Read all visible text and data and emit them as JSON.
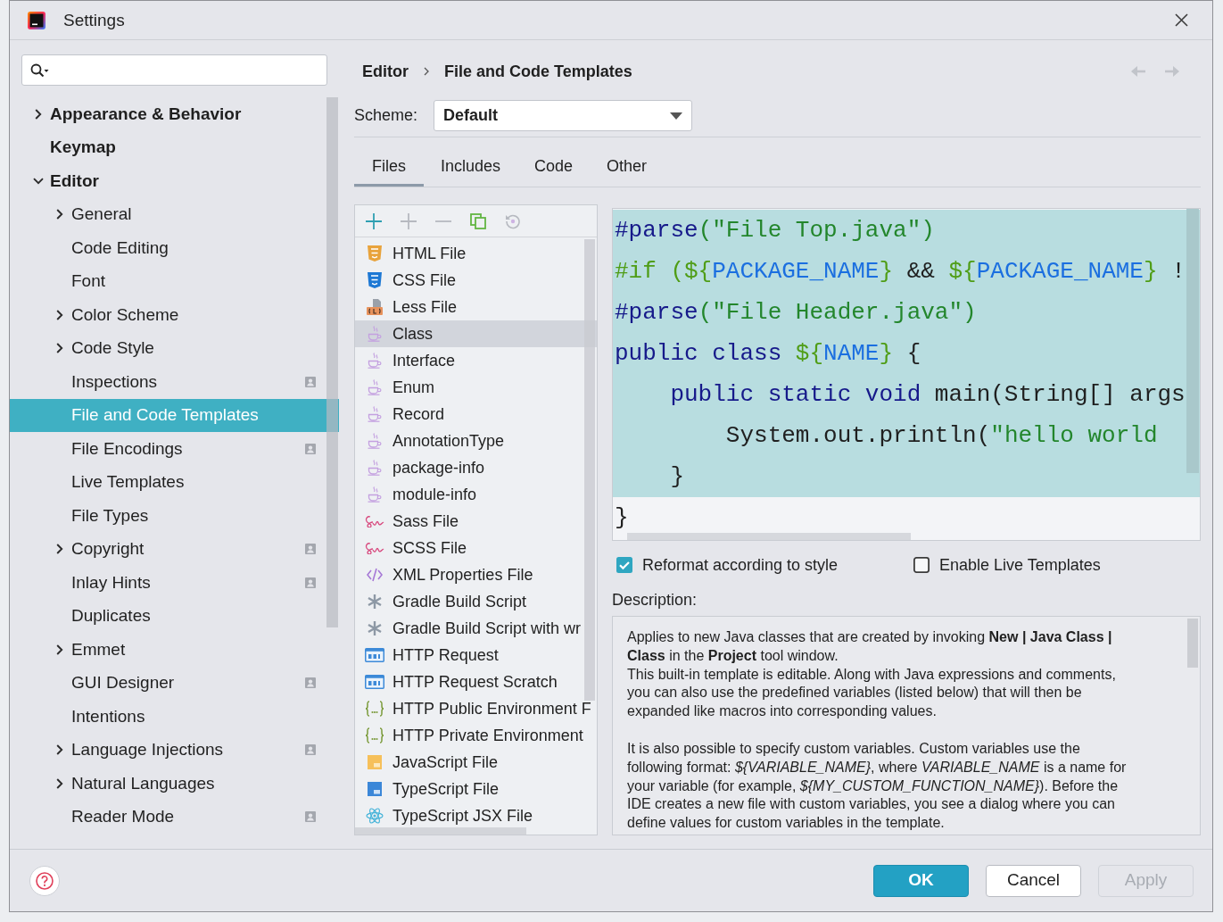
{
  "window": {
    "title": "Settings"
  },
  "sidebar": {
    "items": [
      {
        "label": "Appearance & Behavior",
        "expanded": false,
        "selected": false,
        "badge": false
      },
      {
        "label": "Keymap",
        "selected": false,
        "badge": false
      },
      {
        "label": "Editor",
        "expanded": true,
        "selected": false,
        "badge": false,
        "children": [
          {
            "label": "General",
            "expanded": false,
            "selected": false,
            "badge": false
          },
          {
            "label": "Code Editing",
            "selected": false,
            "badge": false
          },
          {
            "label": "Font",
            "selected": false,
            "badge": false
          },
          {
            "label": "Color Scheme",
            "expanded": false,
            "selected": false,
            "badge": false
          },
          {
            "label": "Code Style",
            "expanded": false,
            "selected": false,
            "badge": false
          },
          {
            "label": "Inspections",
            "selected": false,
            "badge": true
          },
          {
            "label": "File and Code Templates",
            "selected": true,
            "badge": false
          },
          {
            "label": "File Encodings",
            "selected": false,
            "badge": true
          },
          {
            "label": "Live Templates",
            "selected": false,
            "badge": false
          },
          {
            "label": "File Types",
            "selected": false,
            "badge": false
          },
          {
            "label": "Copyright",
            "expanded": false,
            "selected": false,
            "badge": true
          },
          {
            "label": "Inlay Hints",
            "selected": false,
            "badge": true
          },
          {
            "label": "Duplicates",
            "selected": false,
            "badge": false
          },
          {
            "label": "Emmet",
            "expanded": false,
            "selected": false,
            "badge": false
          },
          {
            "label": "GUI Designer",
            "selected": false,
            "badge": true
          },
          {
            "label": "Intentions",
            "selected": false,
            "badge": false
          },
          {
            "label": "Language Injections",
            "expanded": false,
            "selected": false,
            "badge": true
          },
          {
            "label": "Natural Languages",
            "expanded": false,
            "selected": false,
            "badge": false
          },
          {
            "label": "Reader Mode",
            "selected": false,
            "badge": true
          }
        ]
      }
    ]
  },
  "breadcrumb": [
    "Editor",
    "File and Code Templates"
  ],
  "navigation": {
    "back": {
      "disabled": true
    },
    "forward": {
      "disabled": true
    }
  },
  "scheme": {
    "label": "Scheme:",
    "value": "Default"
  },
  "tabs": [
    {
      "label": "Files",
      "selected": true
    },
    {
      "label": "Includes",
      "selected": false
    },
    {
      "label": "Code",
      "selected": false
    },
    {
      "label": "Other",
      "selected": false
    }
  ],
  "template_toolbar": [
    {
      "kind": "add",
      "disabled": false
    },
    {
      "kind": "add",
      "disabled": true
    },
    {
      "kind": "remove",
      "disabled": true
    },
    {
      "kind": "copy",
      "disabled": false
    },
    {
      "kind": "reset",
      "disabled": true
    }
  ],
  "templates": [
    {
      "label": "HTML File",
      "kind": "html",
      "selected": false
    },
    {
      "label": "CSS File",
      "kind": "css",
      "selected": false
    },
    {
      "label": "Less File",
      "kind": "less",
      "selected": false
    },
    {
      "label": "Class",
      "kind": "java",
      "selected": true
    },
    {
      "label": "Interface",
      "kind": "java",
      "selected": false
    },
    {
      "label": "Enum",
      "kind": "java",
      "selected": false
    },
    {
      "label": "Record",
      "kind": "java",
      "selected": false
    },
    {
      "label": "AnnotationType",
      "kind": "java",
      "selected": false
    },
    {
      "label": "package-info",
      "kind": "java",
      "selected": false
    },
    {
      "label": "module-info",
      "kind": "java",
      "selected": false
    },
    {
      "label": "Sass File",
      "kind": "sass",
      "selected": false
    },
    {
      "label": "SCSS File",
      "kind": "sass",
      "selected": false
    },
    {
      "label": "XML Properties File",
      "kind": "xml",
      "selected": false
    },
    {
      "label": "Gradle Build Script",
      "kind": "gradle",
      "selected": false
    },
    {
      "label": "Gradle Build Script with wr",
      "kind": "gradle",
      "selected": false
    },
    {
      "label": "HTTP Request",
      "kind": "http",
      "selected": false
    },
    {
      "label": "HTTP Request Scratch",
      "kind": "http",
      "selected": false
    },
    {
      "label": "HTTP Public Environment F",
      "kind": "env",
      "selected": false
    },
    {
      "label": "HTTP Private Environment",
      "kind": "env",
      "selected": false
    },
    {
      "label": "JavaScript File",
      "kind": "js",
      "selected": false
    },
    {
      "label": "TypeScript File",
      "kind": "ts",
      "selected": false
    },
    {
      "label": "TypeScript JSX File",
      "kind": "tsx",
      "selected": false
    }
  ],
  "code": {
    "lines": [
      {
        "highlighted": true,
        "tokens": [
          {
            "kind": "directive",
            "text": "#parse"
          },
          {
            "kind": "string",
            "text": "(\"File Top.java\")"
          }
        ]
      },
      {
        "highlighted": true,
        "tokens": [
          {
            "kind": "velocity",
            "text": "#if (${"
          },
          {
            "kind": "variable",
            "text": "PACKAGE_NAME"
          },
          {
            "kind": "velocity",
            "text": "}"
          },
          {
            "kind": "plain",
            "text": " && "
          },
          {
            "kind": "velocity",
            "text": "${"
          },
          {
            "kind": "variable",
            "text": "PACKAGE_NAME"
          },
          {
            "kind": "velocity",
            "text": "}"
          },
          {
            "kind": "plain",
            "text": " !"
          }
        ]
      },
      {
        "highlighted": true,
        "tokens": [
          {
            "kind": "directive",
            "text": "#parse"
          },
          {
            "kind": "string",
            "text": "(\"File Header.java\")"
          }
        ]
      },
      {
        "highlighted": true,
        "tokens": [
          {
            "kind": "keyword",
            "text": "public class "
          },
          {
            "kind": "velocity",
            "text": "${"
          },
          {
            "kind": "variable",
            "text": "NAME"
          },
          {
            "kind": "velocity",
            "text": "}"
          },
          {
            "kind": "plain",
            "text": " {"
          }
        ]
      },
      {
        "highlighted": true,
        "tokens": [
          {
            "kind": "keyword",
            "text": "    public static void "
          },
          {
            "kind": "plain",
            "text": "main(String[] args"
          }
        ]
      },
      {
        "highlighted": true,
        "tokens": [
          {
            "kind": "plain",
            "text": "        System.out.println("
          },
          {
            "kind": "string",
            "text": "\"hello world"
          }
        ]
      },
      {
        "highlighted": true,
        "tokens": [
          {
            "kind": "plain",
            "text": "    }"
          }
        ]
      },
      {
        "highlighted": false,
        "tokens": [
          {
            "kind": "plain",
            "text": "}"
          }
        ]
      }
    ]
  },
  "options": [
    {
      "label": "Reformat according to style",
      "checked": true
    },
    {
      "label": "Enable Live Templates",
      "checked": false
    }
  ],
  "description": {
    "label": "Description:",
    "paragraphs": [
      [
        "Applies to new Java classes that are created by invoking **New | Java Class | Class** in the **Project** tool window.",
        "This built-in template is editable. Along with Java expressions and comments, you can also use the predefined variables (listed below) that will then be expanded like macros into corresponding values."
      ],
      [
        "It is also possible to specify custom variables. Custom variables use the following format: *${VARIABLE_NAME}*, where *VARIABLE_NAME* is a name for your variable (for example, *${MY_CUSTOM_FUNCTION_NAME}*). Before the IDE creates a new file with custom variables, you see a dialog where you can define values for custom variables in the template."
      ]
    ]
  },
  "buttons": [
    {
      "label": "OK",
      "kind": "primary",
      "disabled": false
    },
    {
      "label": "Cancel",
      "kind": "default",
      "disabled": false
    },
    {
      "label": "Apply",
      "kind": "default",
      "disabled": true
    }
  ]
}
